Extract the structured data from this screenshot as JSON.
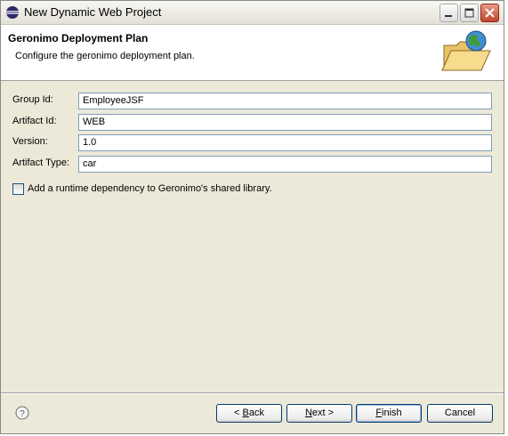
{
  "window": {
    "title": "New Dynamic Web Project"
  },
  "banner": {
    "title": "Geronimo Deployment Plan",
    "description": "Configure the geronimo deployment plan.",
    "icon": "folder-globe-icon"
  },
  "form": {
    "fields": [
      {
        "label": "Group Id:",
        "value": "EmployeeJSF"
      },
      {
        "label": "Artifact Id:",
        "value": "WEB"
      },
      {
        "label": "Version:",
        "value": "1.0"
      },
      {
        "label": "Artifact Type:",
        "value": "car"
      }
    ],
    "shared_library_checkbox": {
      "label": "Add a runtime dependency to Geronimo's shared library.",
      "checked": false
    }
  },
  "buttons": {
    "back": {
      "mnemonic": "B",
      "rest": "ack",
      "prefix": "< "
    },
    "next": {
      "mnemonic": "N",
      "rest": "ext >"
    },
    "finish": {
      "mnemonic": "F",
      "rest": "inish"
    },
    "cancel": "Cancel"
  },
  "help": {
    "icon": "help-icon"
  },
  "colors": {
    "dialog_bg": "#ece9d8",
    "banner_bg": "#ffffff",
    "input_border": "#7f9db9",
    "button_border": "#003c74"
  }
}
